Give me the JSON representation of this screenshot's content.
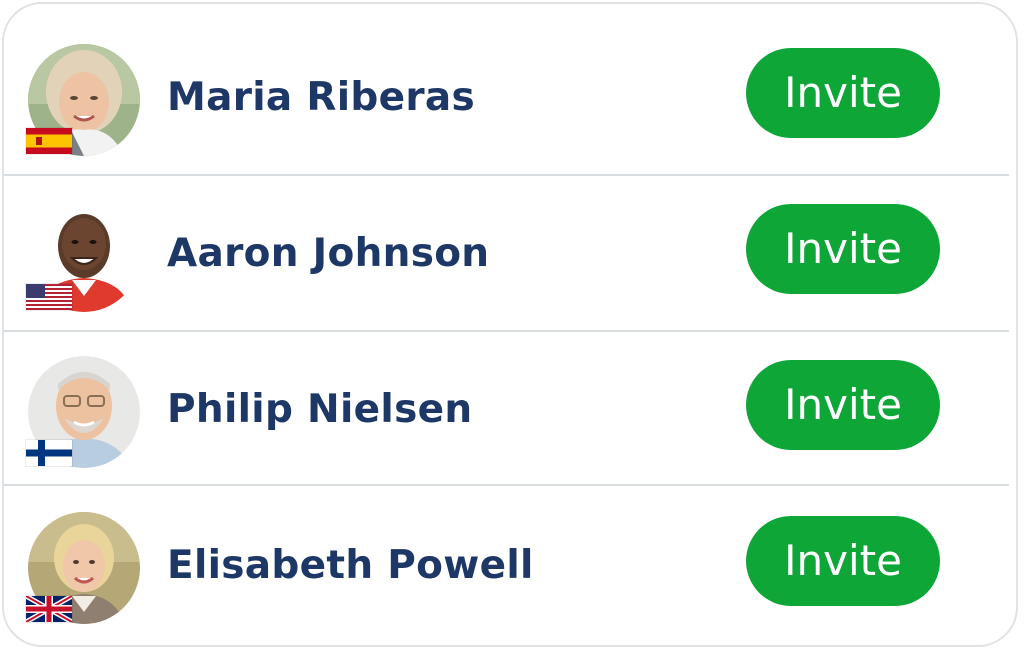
{
  "contacts": [
    {
      "name": "Maria Riberas",
      "country_flag": "spain-flag",
      "avatar": "avatar-woman-blonde-gray",
      "action_label": "Invite"
    },
    {
      "name": "Aaron Johnson",
      "country_flag": "usa-flag",
      "avatar": "avatar-man-red-shirt",
      "action_label": "Invite"
    },
    {
      "name": "Philip Nielsen",
      "country_flag": "finland-flag",
      "avatar": "avatar-man-glasses-beard",
      "action_label": "Invite"
    },
    {
      "name": "Elisabeth Powell",
      "country_flag": "uk-flag",
      "avatar": "avatar-woman-blonde-suit",
      "action_label": "Invite"
    }
  ],
  "colors": {
    "name_text": "#1d3766",
    "invite_button": "#0fa638",
    "invite_text": "#ffffff",
    "divider": "#d7dde0",
    "card_border": "#dfe3e6"
  }
}
